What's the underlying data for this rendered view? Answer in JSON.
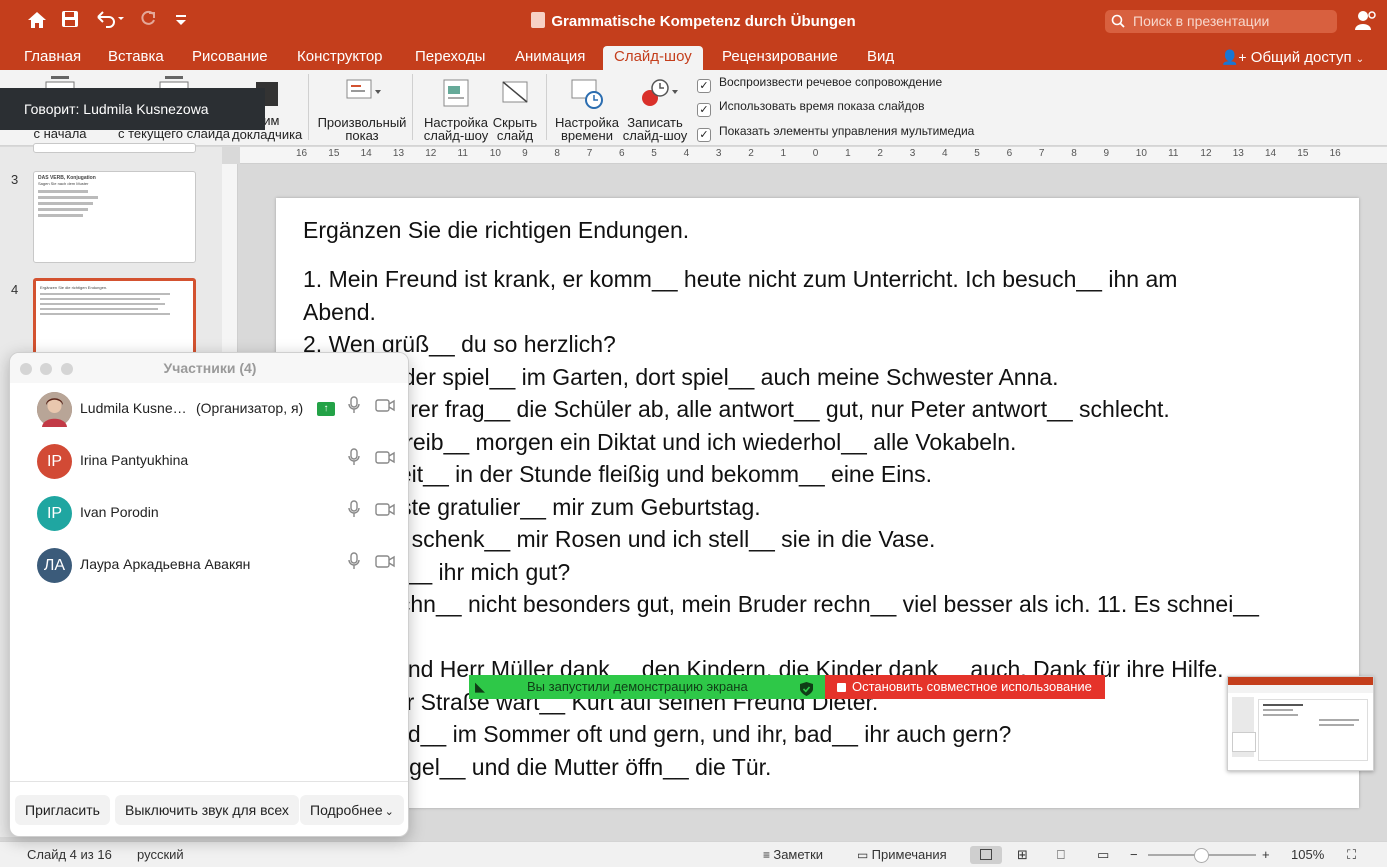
{
  "title_bar": {
    "title": "Grammatische Kompetenz durch Übungen",
    "search_placeholder": "Поиск в презентации",
    "share_label": "Общий доступ"
  },
  "tabs": [
    "Главная",
    "Вставка",
    "Рисование",
    "Конструктор",
    "Переходы",
    "Анимация",
    "Слайд-шоу",
    "Рецензирование",
    "Вид"
  ],
  "active_tab": "Слайд-шоу",
  "ribbon": {
    "from_start": "с начала",
    "from_current": "с текущего слайда",
    "presenter_line1": "жим",
    "presenter_line2": "докладчика",
    "custom_show_line1": "Произвольный",
    "custom_show_line2": "показ",
    "setup_line1": "Настройка",
    "setup_line2": "слайд-шоу",
    "hide_line1": "Скрыть",
    "hide_line2": "слайд",
    "rehearse_line1": "Настройка",
    "rehearse_line2": "времени",
    "record_line1": "Записать",
    "record_line2": "слайд-шоу",
    "checkboxes": [
      "Воспроизвести речевое сопровождение",
      "Использовать время показа слайдов",
      "Показать элементы управления мультимедиа"
    ]
  },
  "speaking": "Говорит: Ludmila Kusnezowa",
  "ruler_labels": [
    "16",
    "15",
    "14",
    "13",
    "12",
    "11",
    "10",
    "9",
    "8",
    "7",
    "6",
    "5",
    "4",
    "3",
    "2",
    "1",
    "0",
    "1",
    "2",
    "3",
    "4",
    "5",
    "6",
    "7",
    "8",
    "9",
    "10",
    "11",
    "12",
    "13",
    "14",
    "15",
    "16"
  ],
  "thumbnails": {
    "num3": "3",
    "num4": "4",
    "t3_title": "DAS VERB, Konjugation",
    "t3_sub": "Sagen Sie nach dem Muster",
    "t4_title": "Ergänzen Sie die richtigen Endungen."
  },
  "slide": {
    "lines": [
      "Ergänzen Sie die richtigen Endungen.",
      "1. Mein Freund ist krank, er komm__ heute nicht zum Unterricht. Ich besuch__ ihn am",
      "Abend.",
      "2. Wen grüß__ du so herzlich?",
      "3. Die Kinder spiel__ im Garten, dort spiel__ auch meine Schwester Anna.",
      "4. Der Lehrer frag__ die Schüler ab, alle antwort__ gut, nur Peter antwort__ schlecht.",
      "5. Wir schreib__ morgen ein Diktat und ich wiederhol__ alle Vokabeln.",
      "6. Ich arbeit__ in der Stunde fleißig und bekomm__ eine Eins.",
      "7. Die Gäste gratulier__ mir zum Geburtstag.",
      "8. Sascha schenk__ mir Rosen und ich stell__ sie in die Vase.",
      "9. Versteh__ ihr mich gut?",
      "10. Ich rechn__ nicht besonders gut, mein Bruder rechn__ viel besser als ich. 11. Es schnei__",
      "",
      "12. Frau und Herr Müller dank__ den Kindern, die Kinder dank__ auch. Dank für ihre Hilfe.",
      "13. Auf der Straße wart__ Kurt auf seinen Freund Dieter.",
      "14. Wir bad__ im Sommer oft und gern, und ihr, bad__ ihr auch gern?",
      "15. Es klingel__ und die Mutter öffn__ die Tür."
    ]
  },
  "participants": {
    "title": "Участники (4)",
    "list": [
      {
        "name": "Ludmila Kusne…",
        "role": "(Организатор, я)",
        "initials": "",
        "color": "#8a6a5a"
      },
      {
        "name": "Irina Pantyukhina",
        "role": "",
        "initials": "IP",
        "color": "#d24a35"
      },
      {
        "name": "Ivan Porodin",
        "role": "",
        "initials": "IP",
        "color": "#1fa6a1"
      },
      {
        "name": "Лаура Аркадьевна Авакян",
        "role": "",
        "initials": "ЛА",
        "color": "#3b5b7a"
      }
    ],
    "invite": "Пригласить",
    "mute_all": "Выключить звук для всех",
    "more": "Подробнее"
  },
  "share_bar": {
    "started": "Вы запустили демонстрацию экрана",
    "stop": "Остановить совместное использование"
  },
  "status": {
    "slide_info": "Слайд 4 из 16",
    "language": "русский",
    "notes": "Заметки",
    "comments": "Примечания",
    "zoom": "105%"
  },
  "colors": {
    "accent": "#c43e1c",
    "share_green": "#2ec848",
    "stop_red": "#e5332a"
  }
}
